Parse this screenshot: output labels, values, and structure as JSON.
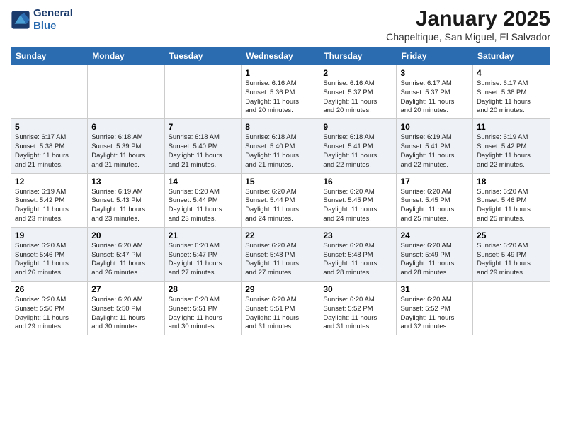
{
  "header": {
    "logo_line1": "General",
    "logo_line2": "Blue",
    "month_title": "January 2025",
    "subtitle": "Chapeltique, San Miguel, El Salvador"
  },
  "weekdays": [
    "Sunday",
    "Monday",
    "Tuesday",
    "Wednesday",
    "Thursday",
    "Friday",
    "Saturday"
  ],
  "weeks": [
    [
      {
        "day": "",
        "info": ""
      },
      {
        "day": "",
        "info": ""
      },
      {
        "day": "",
        "info": ""
      },
      {
        "day": "1",
        "info": "Sunrise: 6:16 AM\nSunset: 5:36 PM\nDaylight: 11 hours\nand 20 minutes."
      },
      {
        "day": "2",
        "info": "Sunrise: 6:16 AM\nSunset: 5:37 PM\nDaylight: 11 hours\nand 20 minutes."
      },
      {
        "day": "3",
        "info": "Sunrise: 6:17 AM\nSunset: 5:37 PM\nDaylight: 11 hours\nand 20 minutes."
      },
      {
        "day": "4",
        "info": "Sunrise: 6:17 AM\nSunset: 5:38 PM\nDaylight: 11 hours\nand 20 minutes."
      }
    ],
    [
      {
        "day": "5",
        "info": "Sunrise: 6:17 AM\nSunset: 5:38 PM\nDaylight: 11 hours\nand 21 minutes."
      },
      {
        "day": "6",
        "info": "Sunrise: 6:18 AM\nSunset: 5:39 PM\nDaylight: 11 hours\nand 21 minutes."
      },
      {
        "day": "7",
        "info": "Sunrise: 6:18 AM\nSunset: 5:40 PM\nDaylight: 11 hours\nand 21 minutes."
      },
      {
        "day": "8",
        "info": "Sunrise: 6:18 AM\nSunset: 5:40 PM\nDaylight: 11 hours\nand 21 minutes."
      },
      {
        "day": "9",
        "info": "Sunrise: 6:18 AM\nSunset: 5:41 PM\nDaylight: 11 hours\nand 22 minutes."
      },
      {
        "day": "10",
        "info": "Sunrise: 6:19 AM\nSunset: 5:41 PM\nDaylight: 11 hours\nand 22 minutes."
      },
      {
        "day": "11",
        "info": "Sunrise: 6:19 AM\nSunset: 5:42 PM\nDaylight: 11 hours\nand 22 minutes."
      }
    ],
    [
      {
        "day": "12",
        "info": "Sunrise: 6:19 AM\nSunset: 5:42 PM\nDaylight: 11 hours\nand 23 minutes."
      },
      {
        "day": "13",
        "info": "Sunrise: 6:19 AM\nSunset: 5:43 PM\nDaylight: 11 hours\nand 23 minutes."
      },
      {
        "day": "14",
        "info": "Sunrise: 6:20 AM\nSunset: 5:44 PM\nDaylight: 11 hours\nand 23 minutes."
      },
      {
        "day": "15",
        "info": "Sunrise: 6:20 AM\nSunset: 5:44 PM\nDaylight: 11 hours\nand 24 minutes."
      },
      {
        "day": "16",
        "info": "Sunrise: 6:20 AM\nSunset: 5:45 PM\nDaylight: 11 hours\nand 24 minutes."
      },
      {
        "day": "17",
        "info": "Sunrise: 6:20 AM\nSunset: 5:45 PM\nDaylight: 11 hours\nand 25 minutes."
      },
      {
        "day": "18",
        "info": "Sunrise: 6:20 AM\nSunset: 5:46 PM\nDaylight: 11 hours\nand 25 minutes."
      }
    ],
    [
      {
        "day": "19",
        "info": "Sunrise: 6:20 AM\nSunset: 5:46 PM\nDaylight: 11 hours\nand 26 minutes."
      },
      {
        "day": "20",
        "info": "Sunrise: 6:20 AM\nSunset: 5:47 PM\nDaylight: 11 hours\nand 26 minutes."
      },
      {
        "day": "21",
        "info": "Sunrise: 6:20 AM\nSunset: 5:47 PM\nDaylight: 11 hours\nand 27 minutes."
      },
      {
        "day": "22",
        "info": "Sunrise: 6:20 AM\nSunset: 5:48 PM\nDaylight: 11 hours\nand 27 minutes."
      },
      {
        "day": "23",
        "info": "Sunrise: 6:20 AM\nSunset: 5:48 PM\nDaylight: 11 hours\nand 28 minutes."
      },
      {
        "day": "24",
        "info": "Sunrise: 6:20 AM\nSunset: 5:49 PM\nDaylight: 11 hours\nand 28 minutes."
      },
      {
        "day": "25",
        "info": "Sunrise: 6:20 AM\nSunset: 5:49 PM\nDaylight: 11 hours\nand 29 minutes."
      }
    ],
    [
      {
        "day": "26",
        "info": "Sunrise: 6:20 AM\nSunset: 5:50 PM\nDaylight: 11 hours\nand 29 minutes."
      },
      {
        "day": "27",
        "info": "Sunrise: 6:20 AM\nSunset: 5:50 PM\nDaylight: 11 hours\nand 30 minutes."
      },
      {
        "day": "28",
        "info": "Sunrise: 6:20 AM\nSunset: 5:51 PM\nDaylight: 11 hours\nand 30 minutes."
      },
      {
        "day": "29",
        "info": "Sunrise: 6:20 AM\nSunset: 5:51 PM\nDaylight: 11 hours\nand 31 minutes."
      },
      {
        "day": "30",
        "info": "Sunrise: 6:20 AM\nSunset: 5:52 PM\nDaylight: 11 hours\nand 31 minutes."
      },
      {
        "day": "31",
        "info": "Sunrise: 6:20 AM\nSunset: 5:52 PM\nDaylight: 11 hours\nand 32 minutes."
      },
      {
        "day": "",
        "info": ""
      }
    ]
  ]
}
